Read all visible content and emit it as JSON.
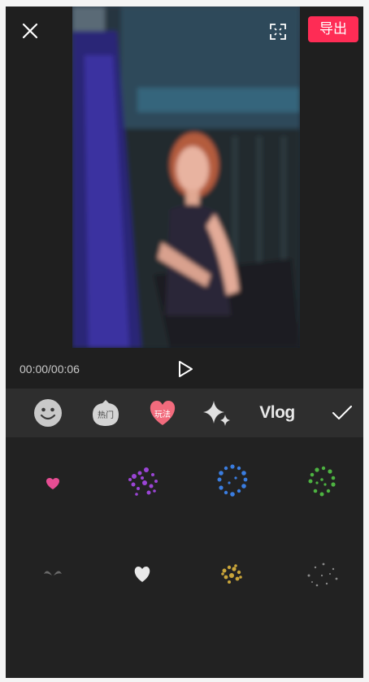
{
  "header": {
    "export_label": "导出",
    "close_icon": "close-icon",
    "fullscreen_icon": "fullscreen-icon"
  },
  "player": {
    "time": "00:00/00:06",
    "play_icon": "play-icon"
  },
  "tabs": [
    {
      "name": "sticker",
      "icon": "smiley-icon",
      "label": ""
    },
    {
      "name": "hot",
      "icon": "hot-bubble-icon",
      "label": "热门"
    },
    {
      "name": "play",
      "icon": "heart-icon",
      "label": "玩法"
    },
    {
      "name": "sparkle",
      "icon": "sparkle-icon",
      "label": ""
    },
    {
      "name": "vlog",
      "icon": "",
      "label": "Vlog"
    }
  ],
  "confirm_icon": "check-icon",
  "colors": {
    "accent": "#fe2c55",
    "heart_tab": "#f26b7d",
    "background": "#1f1f1f",
    "tabbar": "#2e2e2e"
  },
  "effects": [
    {
      "name": "small-pink-heart",
      "color": "#e64d93"
    },
    {
      "name": "purple-particles",
      "color": "#9b45d6"
    },
    {
      "name": "blue-particle-ring",
      "color": "#3a7de0"
    },
    {
      "name": "green-particle-ring",
      "color": "#4db341"
    },
    {
      "name": "dark-wings",
      "color": "#6a6a6a"
    },
    {
      "name": "white-heart",
      "color": "#e9e9e9"
    },
    {
      "name": "gold-particles",
      "color": "#c9a53a"
    },
    {
      "name": "grey-dots",
      "color": "#8a8a8a"
    }
  ]
}
